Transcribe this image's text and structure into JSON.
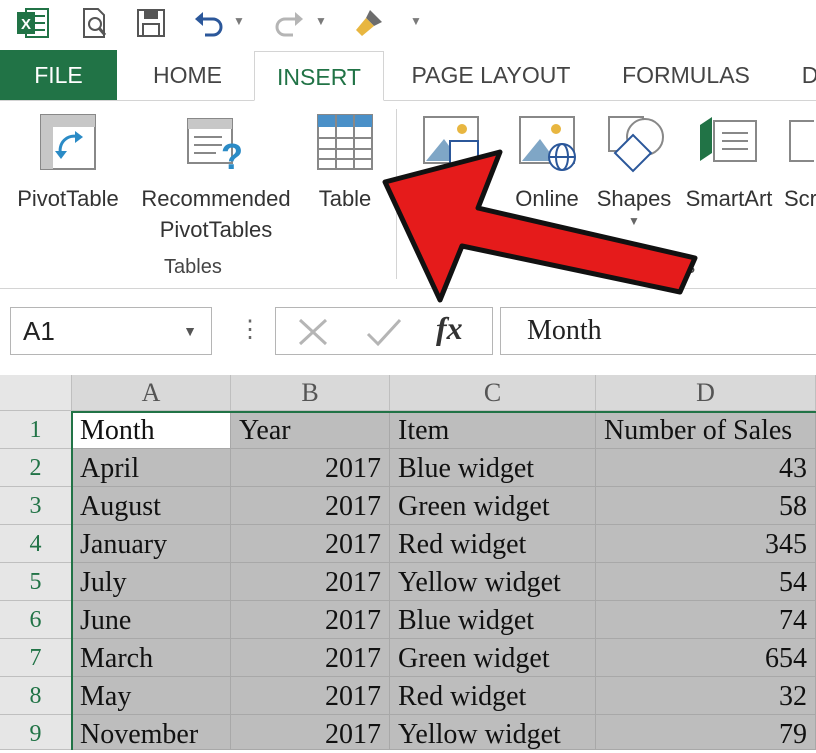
{
  "qat": {
    "app_icon": "excel-icon",
    "buttons": [
      "print-preview-icon",
      "save-icon",
      "undo-icon",
      "redo-icon",
      "format-painter-icon",
      "customize-qat-icon"
    ]
  },
  "tabs": [
    "FILE",
    "HOME",
    "INSERT",
    "PAGE LAYOUT",
    "FORMULAS",
    "D"
  ],
  "ribbon": {
    "pivottable": "PivotTable",
    "recommended_1": "Recommended",
    "recommended_2": "PivotTables",
    "table": "Table",
    "tables_group": "Tables",
    "online": "Online",
    "shapes": "Shapes",
    "smartart": "SmartArt",
    "screenshot_partial": "Scr",
    "illustrations_partial": "ns"
  },
  "formula_bar": {
    "name_box": "A1",
    "value": "Month"
  },
  "grid": {
    "columns": [
      "A",
      "B",
      "C",
      "D"
    ],
    "rows": [
      {
        "n": "1",
        "cells": [
          "Month",
          "Year",
          "Item",
          "Number of Sales"
        ]
      },
      {
        "n": "2",
        "cells": [
          "April",
          "2017",
          "Blue widget",
          "43"
        ]
      },
      {
        "n": "3",
        "cells": [
          "August",
          "2017",
          "Green widget",
          "58"
        ]
      },
      {
        "n": "4",
        "cells": [
          "January",
          "2017",
          "Red widget",
          "345"
        ]
      },
      {
        "n": "5",
        "cells": [
          "July",
          "2017",
          "Yellow widget",
          "54"
        ]
      },
      {
        "n": "6",
        "cells": [
          "June",
          "2017",
          "Blue widget",
          "74"
        ]
      },
      {
        "n": "7",
        "cells": [
          "March",
          "2017",
          "Green widget",
          "654"
        ]
      },
      {
        "n": "8",
        "cells": [
          "May",
          "2017",
          "Red widget",
          "32"
        ]
      },
      {
        "n": "9",
        "cells": [
          "November",
          "2017",
          "Yellow widget",
          "79"
        ]
      }
    ]
  },
  "colors": {
    "excel_green": "#217346",
    "annotation_red": "#e51b1b"
  }
}
